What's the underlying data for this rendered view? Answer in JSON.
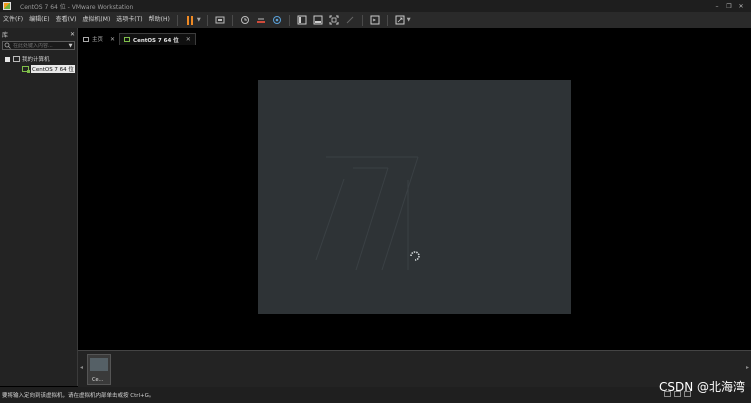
{
  "window": {
    "title": "CentOS 7 64 位 - VMware Workstation",
    "controls": {
      "minimize": "–",
      "restore": "❐",
      "close": "✕"
    }
  },
  "menu": {
    "file": "文件(F)",
    "edit": "编辑(E)",
    "view": "查看(V)",
    "vm": "虚拟机(M)",
    "tabs": "选项卡(T)",
    "help": "帮助(H)"
  },
  "library": {
    "title": "库",
    "close": "✕",
    "search_placeholder": "在此处键入内容...",
    "tree": {
      "root_label": "我的计算机",
      "vm_label": "CentOS 7 64 位"
    }
  },
  "tabs": [
    {
      "label": "主页",
      "close": "✕"
    },
    {
      "label": "CentOS 7 64 位",
      "close": "✕"
    }
  ],
  "thumbnail": {
    "label": "Ce..."
  },
  "statusbar": {
    "text": "要将输入定向到该虚拟机，请在虚拟机内部单击或按 Ctrl+G。"
  },
  "watermark": "CSDN @北海湾",
  "colors": {
    "accent_orange": "#f08a24",
    "vm_green": "#7fbf4a",
    "vm_screen": "#2e3336"
  },
  "icons": [
    "app-icon",
    "pause-icon",
    "send-keys-icon",
    "snapshot-icon",
    "revert-icon",
    "manage-snapshots-icon",
    "library-view-icon",
    "thumbnail-view-icon",
    "fullscreen-icon",
    "unity-icon",
    "console-view-icon",
    "stretch-icon",
    "search-icon",
    "home-icon",
    "vm-icon",
    "spinner-icon"
  ]
}
